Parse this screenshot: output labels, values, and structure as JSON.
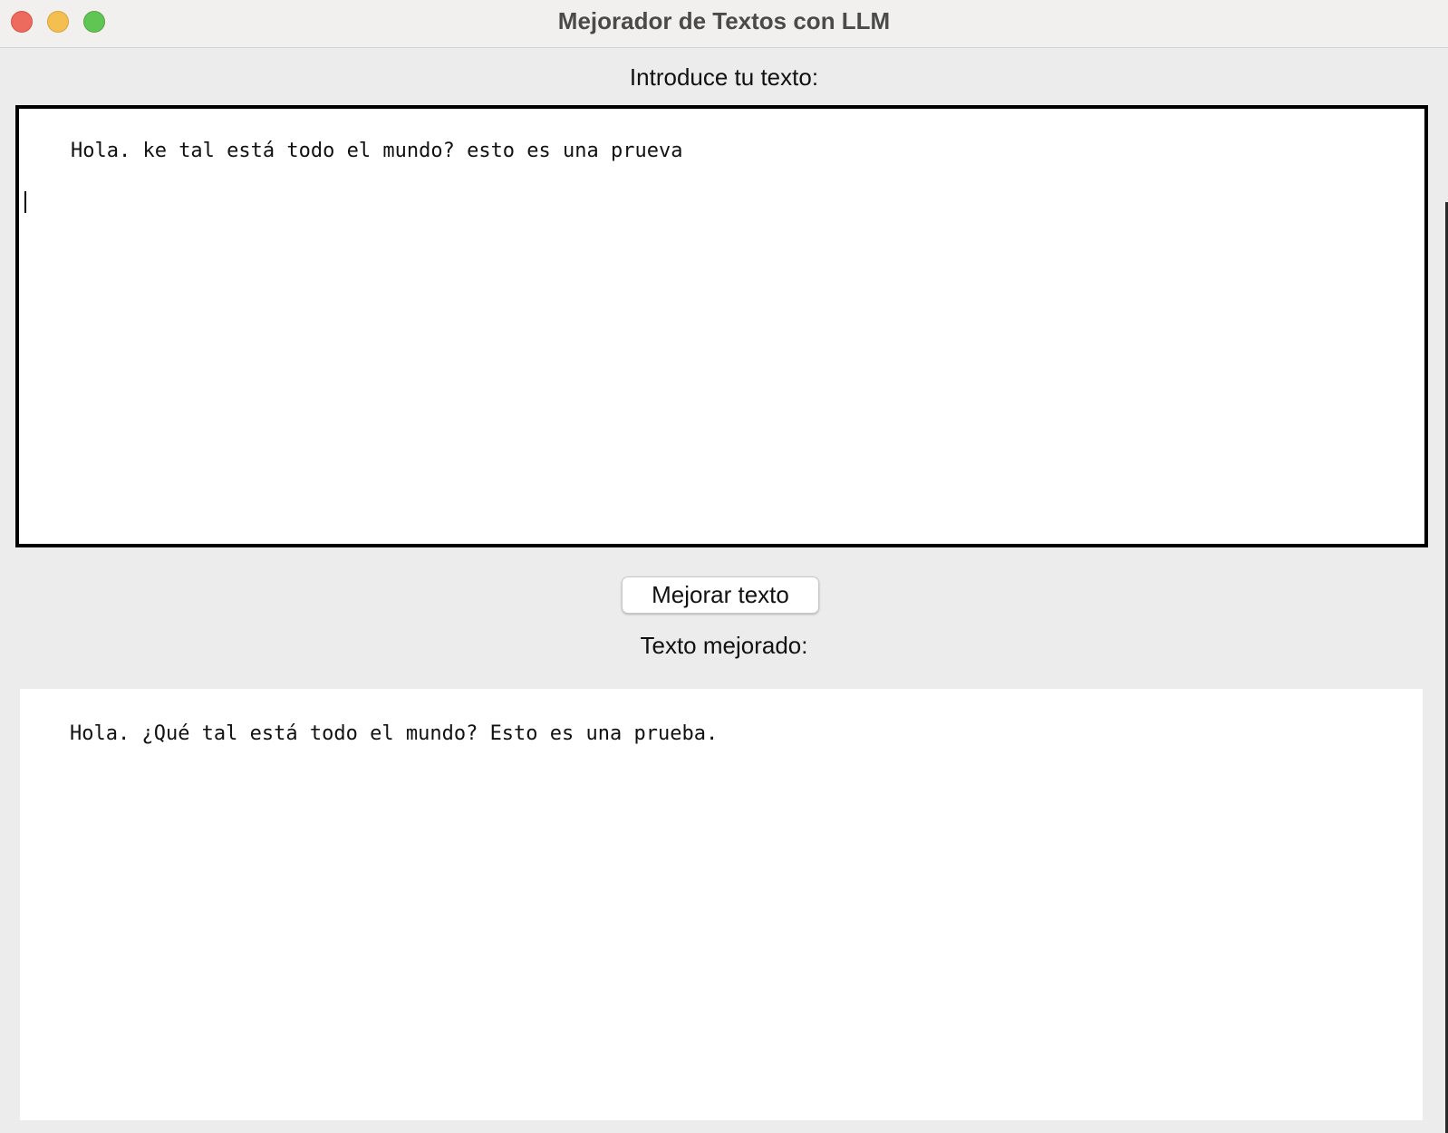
{
  "window": {
    "title": "Mejorador de Textos con LLM"
  },
  "input_section": {
    "label": "Introduce tu texto:",
    "value": "Hola. ke tal está todo el mundo? esto es una prueva"
  },
  "action": {
    "button_label": "Mejorar texto"
  },
  "output_section": {
    "label": "Texto mejorado:",
    "value": "Hola. ¿Qué tal está todo el mundo? Esto es una prueba."
  },
  "colors": {
    "close": "#ed6a5e",
    "minimize": "#f5bf4f",
    "maximize": "#61c554",
    "background": "#ececec"
  }
}
